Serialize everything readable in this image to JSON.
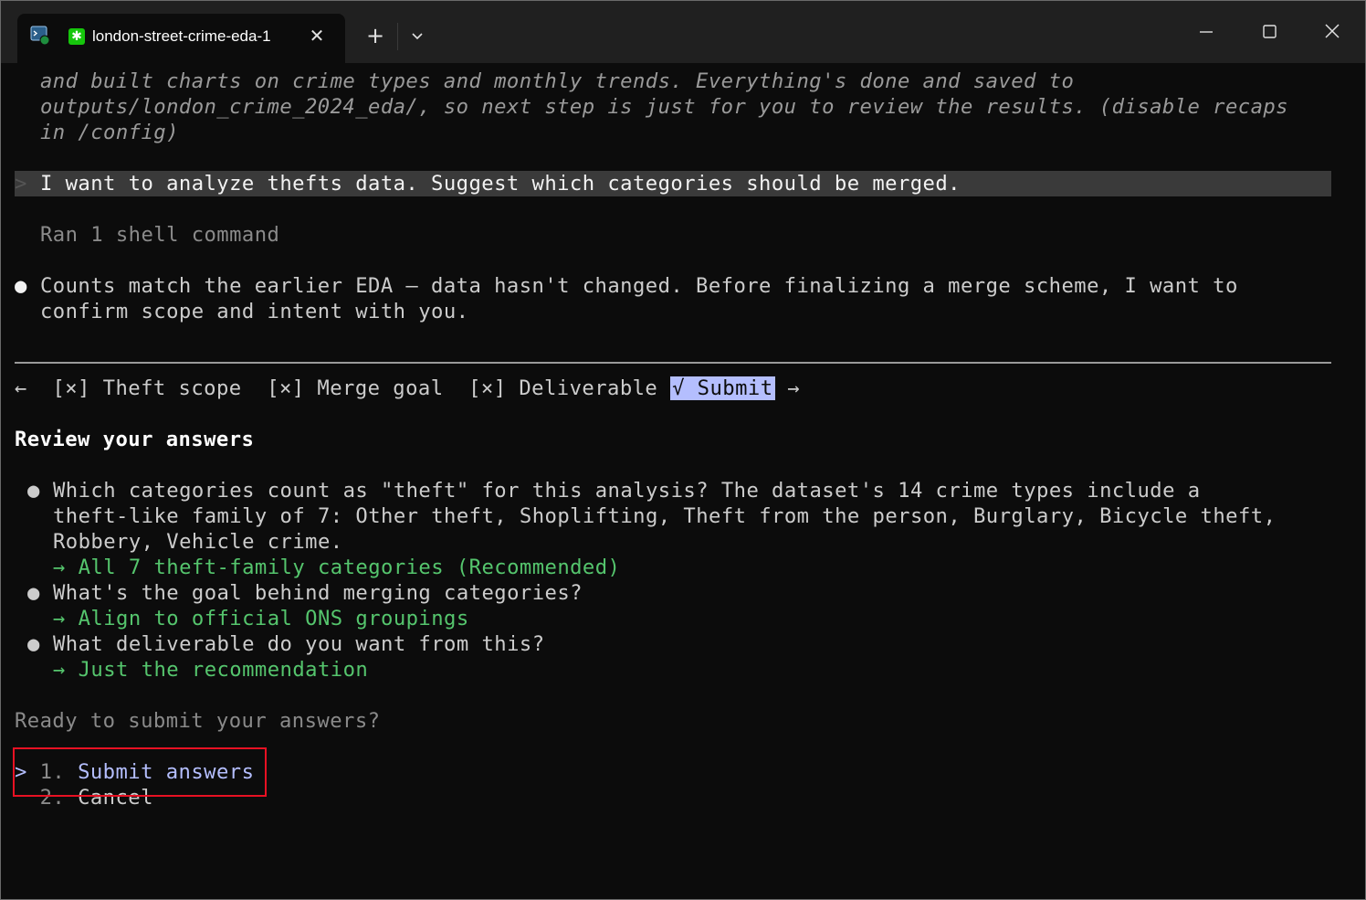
{
  "window": {
    "tab_title": "london-street-crime-eda-1",
    "new_tab_symbol": "+",
    "icons": [
      "terminal-app-icon",
      "tab-favicon-icon",
      "close-icon",
      "plus-icon",
      "chevron-down-icon",
      "minimize-icon",
      "maximize-icon",
      "window-close-icon"
    ]
  },
  "terminal": {
    "recap_lines": [
      "and built charts on crime types and monthly trends. Everything's done and saved to",
      "outputs/london_crime_2024_eda/, so next step is just for you to review the results. (disable recaps",
      "in /config)"
    ],
    "user_prompt_marker": ">",
    "user_message": "I want to analyze thefts data. Suggest which categories should be merged.",
    "ran_line": "Ran 1 shell command",
    "bullet": "●",
    "assistant_lines": [
      "Counts match the earlier EDA — data hasn't changed. Before finalizing a merge scheme, I want to",
      "confirm scope and intent with you."
    ],
    "nav": {
      "left_arrow": "←",
      "tabs": [
        "[×] Theft scope",
        "[×] Merge goal",
        "[×] Deliverable"
      ],
      "submit": "√ Submit",
      "right_arrow": "→"
    },
    "review_heading": "Review your answers",
    "questions": [
      {
        "lines": [
          "Which categories count as \"theft\" for this analysis? The dataset's 14 crime types include a",
          "theft-like family of 7: Other theft, Shoplifting, Theft from the person, Burglary, Bicycle theft,",
          "Robbery, Vehicle crime."
        ],
        "answer": "→ All 7 theft-family categories (Recommended)"
      },
      {
        "lines": [
          "What's the goal behind merging categories?"
        ],
        "answer": "→ Align to official ONS groupings"
      },
      {
        "lines": [
          "What deliverable do you want from this?"
        ],
        "answer": "→ Just the recommendation"
      }
    ],
    "ready_prompt": "Ready to submit your answers?",
    "options": [
      {
        "cursor": ">",
        "number": "1.",
        "label": "Submit answers"
      },
      {
        "cursor": " ",
        "number": "2.",
        "label": "Cancel"
      }
    ]
  }
}
